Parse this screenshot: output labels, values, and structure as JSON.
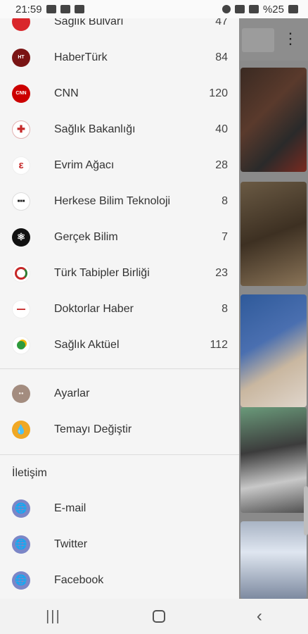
{
  "status_bar": {
    "time": "21:59",
    "battery": "%25"
  },
  "sources": [
    {
      "name": "Sağlık Bulvarı",
      "count": "47",
      "icon": "saglik-bulvari-logo-icon"
    },
    {
      "name": "HaberTürk",
      "count": "84",
      "icon": "haberturk-logo-icon"
    },
    {
      "name": "CNN",
      "count": "120",
      "icon": "cnn-logo-icon"
    },
    {
      "name": "Sağlık Bakanlığı",
      "count": "40",
      "icon": "saglik-bakanligi-logo-icon"
    },
    {
      "name": "Evrim Ağacı",
      "count": "28",
      "icon": "evrim-agaci-logo-icon"
    },
    {
      "name": "Herkese Bilim Teknoloji",
      "count": "8",
      "icon": "herkese-bilim-logo-icon"
    },
    {
      "name": "Gerçek Bilim",
      "count": "7",
      "icon": "gercek-bilim-logo-icon"
    },
    {
      "name": "Türk Tabipler Birliği",
      "count": "23",
      "icon": "ttb-logo-icon"
    },
    {
      "name": "Doktorlar Haber",
      "count": "8",
      "icon": "doktorlar-haber-logo-icon"
    },
    {
      "name": "Sağlık Aktüel",
      "count": "112",
      "icon": "saglik-aktuel-logo-icon"
    }
  ],
  "settings": [
    {
      "label": "Ayarlar",
      "icon": "settings-logo-icon"
    },
    {
      "label": "Temayı Değiştir",
      "icon": "theme-drop-icon"
    }
  ],
  "contact": {
    "title": "İletişim",
    "items": [
      {
        "label": "E-mail",
        "icon": "globe-icon"
      },
      {
        "label": "Twitter",
        "icon": "globe-icon"
      },
      {
        "label": "Facebook",
        "icon": "globe-icon"
      }
    ]
  },
  "colors": {
    "drawer_bg": "#f5f5f5",
    "accent_theme": "#f0a825",
    "globe_icon": "#7b86c7"
  }
}
